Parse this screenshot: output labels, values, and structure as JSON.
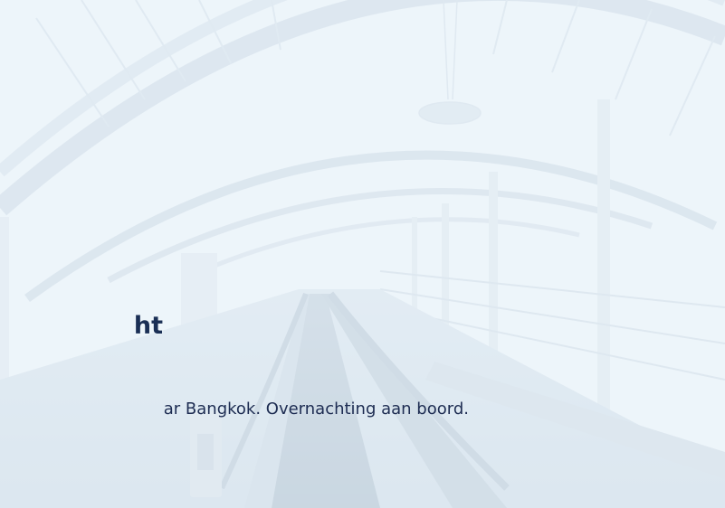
{
  "hero": {
    "background_image": "airport-terminal-walkway",
    "title": "ht",
    "description": "ar Bangkok. Overnachting aan boord."
  },
  "colors": {
    "title": "#1a2f55",
    "text": "#1d2c52",
    "background": "#eef5fa"
  }
}
